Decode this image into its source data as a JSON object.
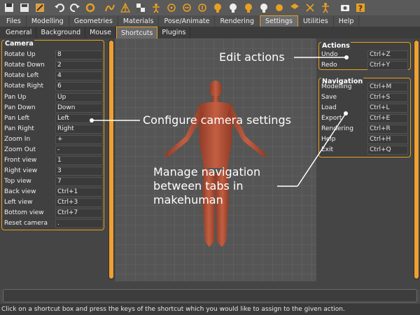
{
  "toolbar": {
    "icons": [
      "undo-icon",
      "redo-icon",
      "reset-icon",
      "smooth-icon",
      "wireframe-icon",
      "background-icon",
      "pose-icon",
      "front-view-icon",
      "back-view-icon",
      "left-view-icon",
      "right-view-icon",
      "top-view-icon",
      "bottom-view-icon",
      "reset-camera-icon",
      "screenshot-icon",
      "help-icon"
    ]
  },
  "main_tabs": [
    "Files",
    "Modelling",
    "Geometries",
    "Materials",
    "Pose/Animate",
    "Rendering",
    "Settings",
    "Utilities",
    "Help"
  ],
  "active_main_tab": "Settings",
  "sub_tabs": [
    "General",
    "Background",
    "Mouse",
    "Shortcuts",
    "Plugins"
  ],
  "active_sub_tab": "Shortcuts",
  "camera": {
    "title": "Camera",
    "rows": [
      {
        "label": "Rotate Up",
        "key": "8"
      },
      {
        "label": "Rotate Down",
        "key": "2"
      },
      {
        "label": "Rotate Left",
        "key": "4"
      },
      {
        "label": "Rotate Right",
        "key": "6"
      },
      {
        "label": "Pan Up",
        "key": "Up"
      },
      {
        "label": "Pan Down",
        "key": "Down"
      },
      {
        "label": "Pan Left",
        "key": "Left"
      },
      {
        "label": "Pan Right",
        "key": "Right"
      },
      {
        "label": "Zoom In",
        "key": "+"
      },
      {
        "label": "Zoom Out",
        "key": "-"
      },
      {
        "label": "Front view",
        "key": "1"
      },
      {
        "label": "Right view",
        "key": "3"
      },
      {
        "label": "Top view",
        "key": "7"
      },
      {
        "label": "Back view",
        "key": "Ctrl+1"
      },
      {
        "label": "Left view",
        "key": "Ctrl+3"
      },
      {
        "label": "Bottom view",
        "key": "Ctrl+7"
      },
      {
        "label": "Reset camera",
        "key": "."
      }
    ]
  },
  "actions": {
    "title": "Actions",
    "rows": [
      {
        "label": "Undo",
        "key": "Ctrl+Z"
      },
      {
        "label": "Redo",
        "key": "Ctrl+Y"
      }
    ]
  },
  "navigation": {
    "title": "Navigation",
    "rows": [
      {
        "label": "Modelling",
        "key": "Ctrl+M"
      },
      {
        "label": "Save",
        "key": "Ctrl+S"
      },
      {
        "label": "Load",
        "key": "Ctrl+L"
      },
      {
        "label": "Export",
        "key": "Ctrl+E"
      },
      {
        "label": "Rendering",
        "key": "Ctrl+R"
      },
      {
        "label": "Help",
        "key": "Ctrl+H"
      },
      {
        "label": "Exit",
        "key": "Ctrl+Q"
      }
    ]
  },
  "annotations": {
    "edit_actions": "Edit actions",
    "configure_camera": "Configure camera settings",
    "manage_nav_1": "Manage navigation",
    "manage_nav_2": "between tabs in",
    "manage_nav_3": "makehuman"
  },
  "status": "Click on a shortcut box and press the keys of the shortcut which you would like to assign to the given action.",
  "colors": {
    "accent": "#e8a020",
    "skin": "#b4553a"
  }
}
